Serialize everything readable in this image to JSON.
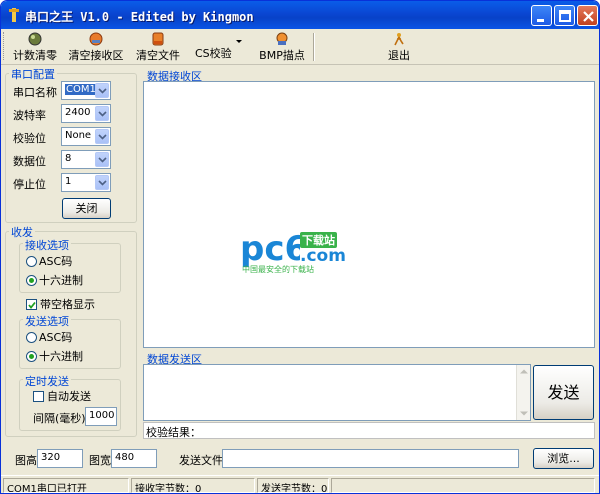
{
  "window": {
    "title": "串口之王 V1.0 - Edited by Kingmon"
  },
  "toolbar": {
    "items": [
      {
        "label": "计数清零",
        "icon": "counter-reset-icon"
      },
      {
        "label": "清空接收区",
        "icon": "clear-receive-icon"
      },
      {
        "label": "清空文件",
        "icon": "clear-file-icon"
      },
      {
        "label": "CS校验",
        "icon": "checksum-icon"
      },
      {
        "label": "BMP描点",
        "icon": "bmp-plot-icon"
      },
      {
        "label": "退出",
        "icon": "exit-icon"
      }
    ]
  },
  "serial_config": {
    "group_label": "串口配置",
    "port_label": "串口名称",
    "port_value": "COM1",
    "baud_label": "波特率",
    "baud_value": "2400",
    "parity_label": "校验位",
    "parity_value": "None",
    "databits_label": "数据位",
    "databits_value": "8",
    "stopbits_label": "停止位",
    "stopbits_value": "1",
    "close_button": "关闭"
  },
  "transceive": {
    "group_label": "收发",
    "receive_options_label": "接收选项",
    "receive_asc": "ASC码",
    "receive_hex": "十六进制",
    "receive_selected": "hex",
    "space_display": "带空格显示",
    "space_display_checked": true,
    "send_options_label": "发送选项",
    "send_asc": "ASC码",
    "send_hex": "十六进制",
    "send_selected": "hex",
    "timer_label": "定时发送",
    "auto_send": "自动发送",
    "auto_send_checked": false,
    "interval_label": "间隔(毫秒)",
    "interval_value": "1000"
  },
  "receive_area": {
    "label": "数据接收区",
    "watermark_brand": "pc6",
    "watermark_badge": "下载站",
    "watermark_com": ".com",
    "watermark_slogan": "中国最安全的下载站"
  },
  "send_area": {
    "label": "数据发送区",
    "send_button": "发送",
    "checksum_label": "校验结果："
  },
  "bottom": {
    "height_label": "图高",
    "height_value": "320",
    "width_label": "图宽",
    "width_value": "480",
    "file_label": "发送文件",
    "file_value": "",
    "browse_button": "浏览..."
  },
  "status_bar": {
    "port_status": "COM1串口已打开",
    "received_bytes": "接收字节数：0",
    "sent_bytes": "发送字节数：0"
  },
  "colors": {
    "title_bar": "#0a54e6",
    "group_label": "#0046d5",
    "watermark_blue": "#1a86d6",
    "watermark_green": "#39b24a"
  }
}
